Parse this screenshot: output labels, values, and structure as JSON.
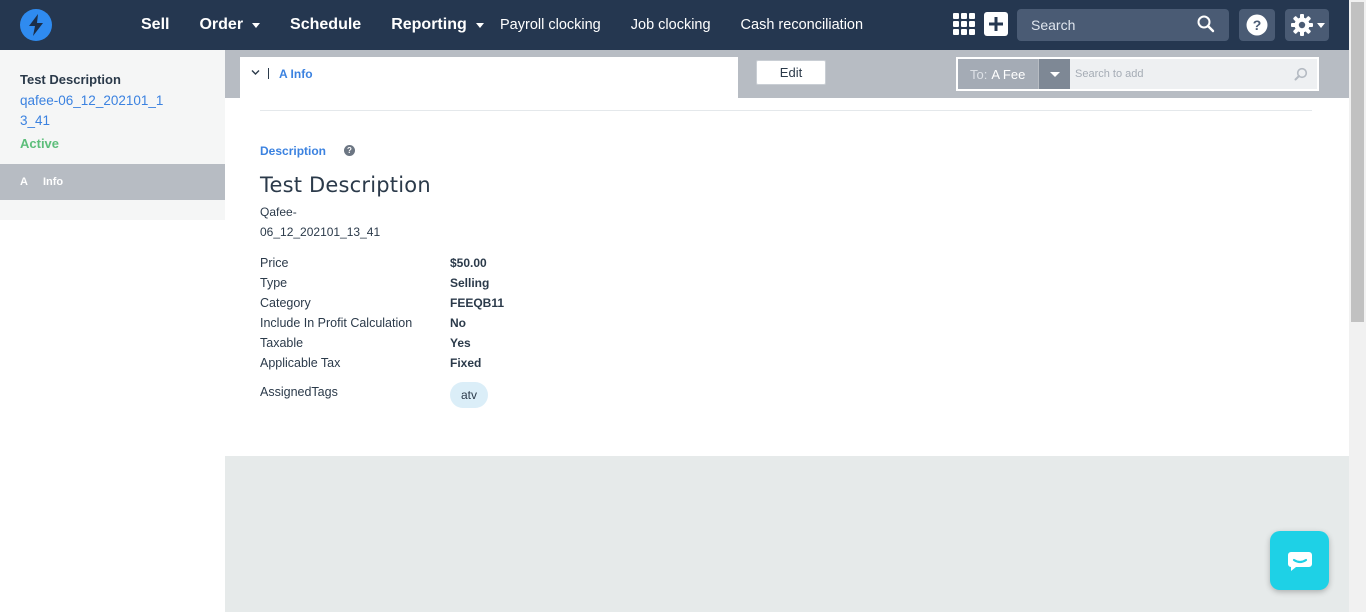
{
  "nav": {
    "main_items": [
      "Sell",
      "Order",
      "Schedule",
      "Reporting"
    ],
    "sub_items": [
      "Payroll clocking",
      "Job clocking",
      "Cash reconciliation"
    ],
    "search_placeholder": "Search"
  },
  "sidebar": {
    "title": "Test Description",
    "code": "qafee-06_12_202101_13_41",
    "status": "Active",
    "nav_item": {
      "prefix": "A",
      "label": "Info"
    }
  },
  "toolbar": {
    "tab_label": "A Info",
    "edit_label": "Edit",
    "to_prefix": "To:",
    "to_value": "A Fee",
    "search_placeholder": "Search to add"
  },
  "detail": {
    "section_title": "Description",
    "title": "Test Description",
    "code": "Qafee-06_12_202101_13_41",
    "properties": [
      {
        "key": "Price",
        "value": "$50.00"
      },
      {
        "key": "Type",
        "value": "Selling"
      },
      {
        "key": "Category",
        "value": "FEEQB11"
      },
      {
        "key": "Include In Profit Calculation",
        "value": "No"
      },
      {
        "key": "Taxable",
        "value": "Yes"
      },
      {
        "key": "Applicable Tax",
        "value": "Fixed"
      }
    ],
    "tags_label": "AssignedTags",
    "tags": [
      "atv"
    ]
  },
  "colors": {
    "topbar": "#253750",
    "accent": "#3b82e0",
    "active": "#5cbe7a",
    "chat": "#1ed1e6"
  }
}
